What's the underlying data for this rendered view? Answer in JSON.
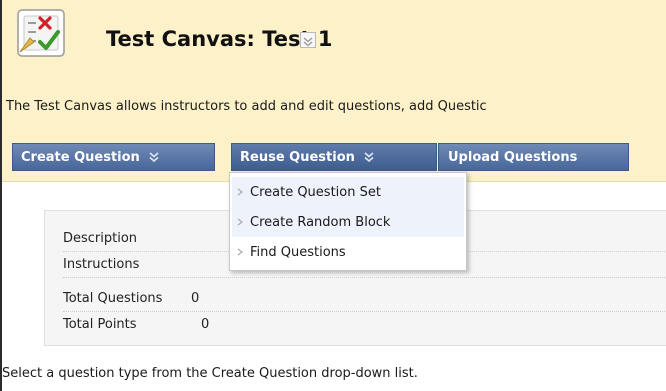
{
  "page": {
    "title": "Test Canvas: Test 1",
    "description": "The Test Canvas allows instructors to add and edit questions, add Questic",
    "footer_hint": "Select a question type from the Create Question drop-down list."
  },
  "icons": {
    "title_icon": "test-checklist-icon",
    "title_menu": "chevron-down-icon",
    "button_chevron": "double-chevron-down-icon",
    "menu_arrow": "chevron-right-icon"
  },
  "toolbar": {
    "create_question": "Create Question",
    "reuse_question": "Reuse Question",
    "upload_questions": "Upload Questions"
  },
  "reuse_menu": {
    "items": [
      {
        "label": "Create Question Set"
      },
      {
        "label": "Create Random Block"
      },
      {
        "label": "Find Questions"
      }
    ]
  },
  "test_properties": {
    "rows": [
      {
        "label": "Description",
        "value": ""
      },
      {
        "label": "Instructions",
        "value": ""
      },
      {
        "label": "Total Questions",
        "value": "0"
      },
      {
        "label": "Total Points",
        "value": "0"
      }
    ]
  },
  "colors": {
    "header_background": "#fcf1c8",
    "button_blue": "#5a77a8",
    "menu_item_bg": "#eef2fb"
  }
}
